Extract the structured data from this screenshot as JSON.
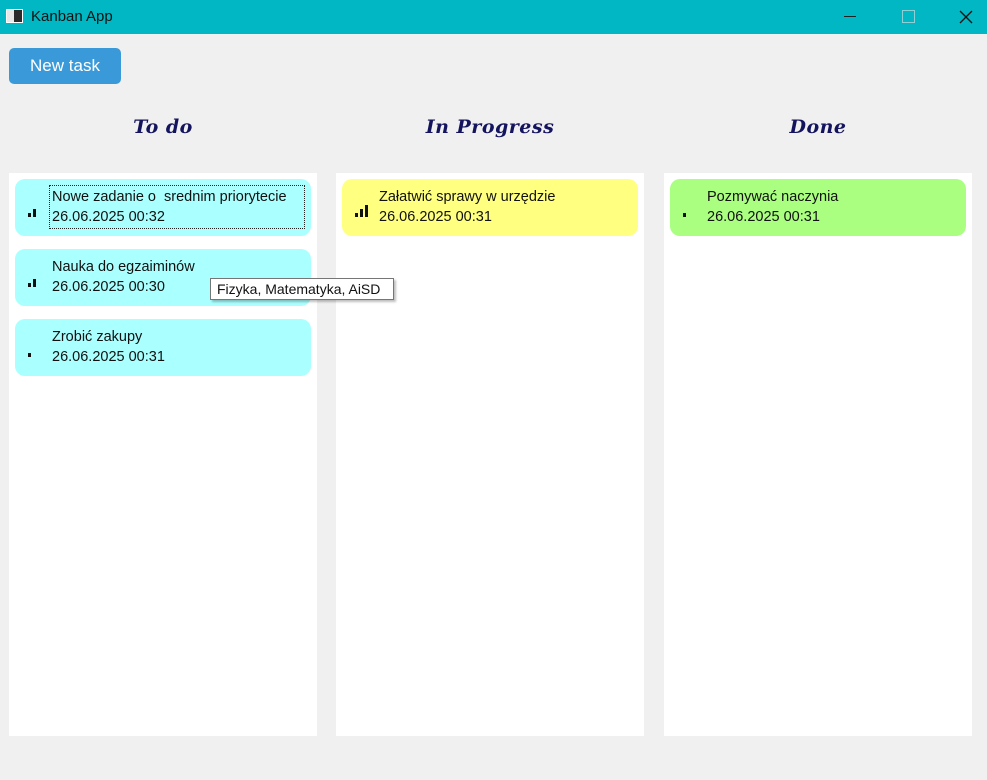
{
  "window": {
    "title": "Kanban App",
    "accent": "#00b7c3"
  },
  "toolbar": {
    "new_task_label": "New task"
  },
  "columns": [
    {
      "title": "To do",
      "cards": [
        {
          "title": "Nowe zadanie o  srednim priorytecie",
          "date": "26.06.2025 00:32",
          "priority_bars": 2,
          "color": "#aaffff"
        },
        {
          "title": "Nauka do egzaiminów",
          "date": "26.06.2025 00:30",
          "priority_bars": 2,
          "color": "#aaffff"
        },
        {
          "title": "Zrobić zakupy",
          "date": "26.06.2025 00:31",
          "priority_bars": 1,
          "color": "#aaffff"
        }
      ]
    },
    {
      "title": "In Progress",
      "cards": [
        {
          "title": "Załatwić sprawy w urzędzie",
          "date": "26.06.2025 00:31",
          "priority_bars": 3,
          "color": "#ffff80"
        }
      ]
    },
    {
      "title": "Done",
      "cards": [
        {
          "title": "Pozmywać naczynia",
          "date": "26.06.2025 00:31",
          "priority_bars": 1,
          "color": "#aaff80"
        }
      ]
    }
  ],
  "tooltip": {
    "text": "Fizyka, Matematyka, AiSD"
  }
}
